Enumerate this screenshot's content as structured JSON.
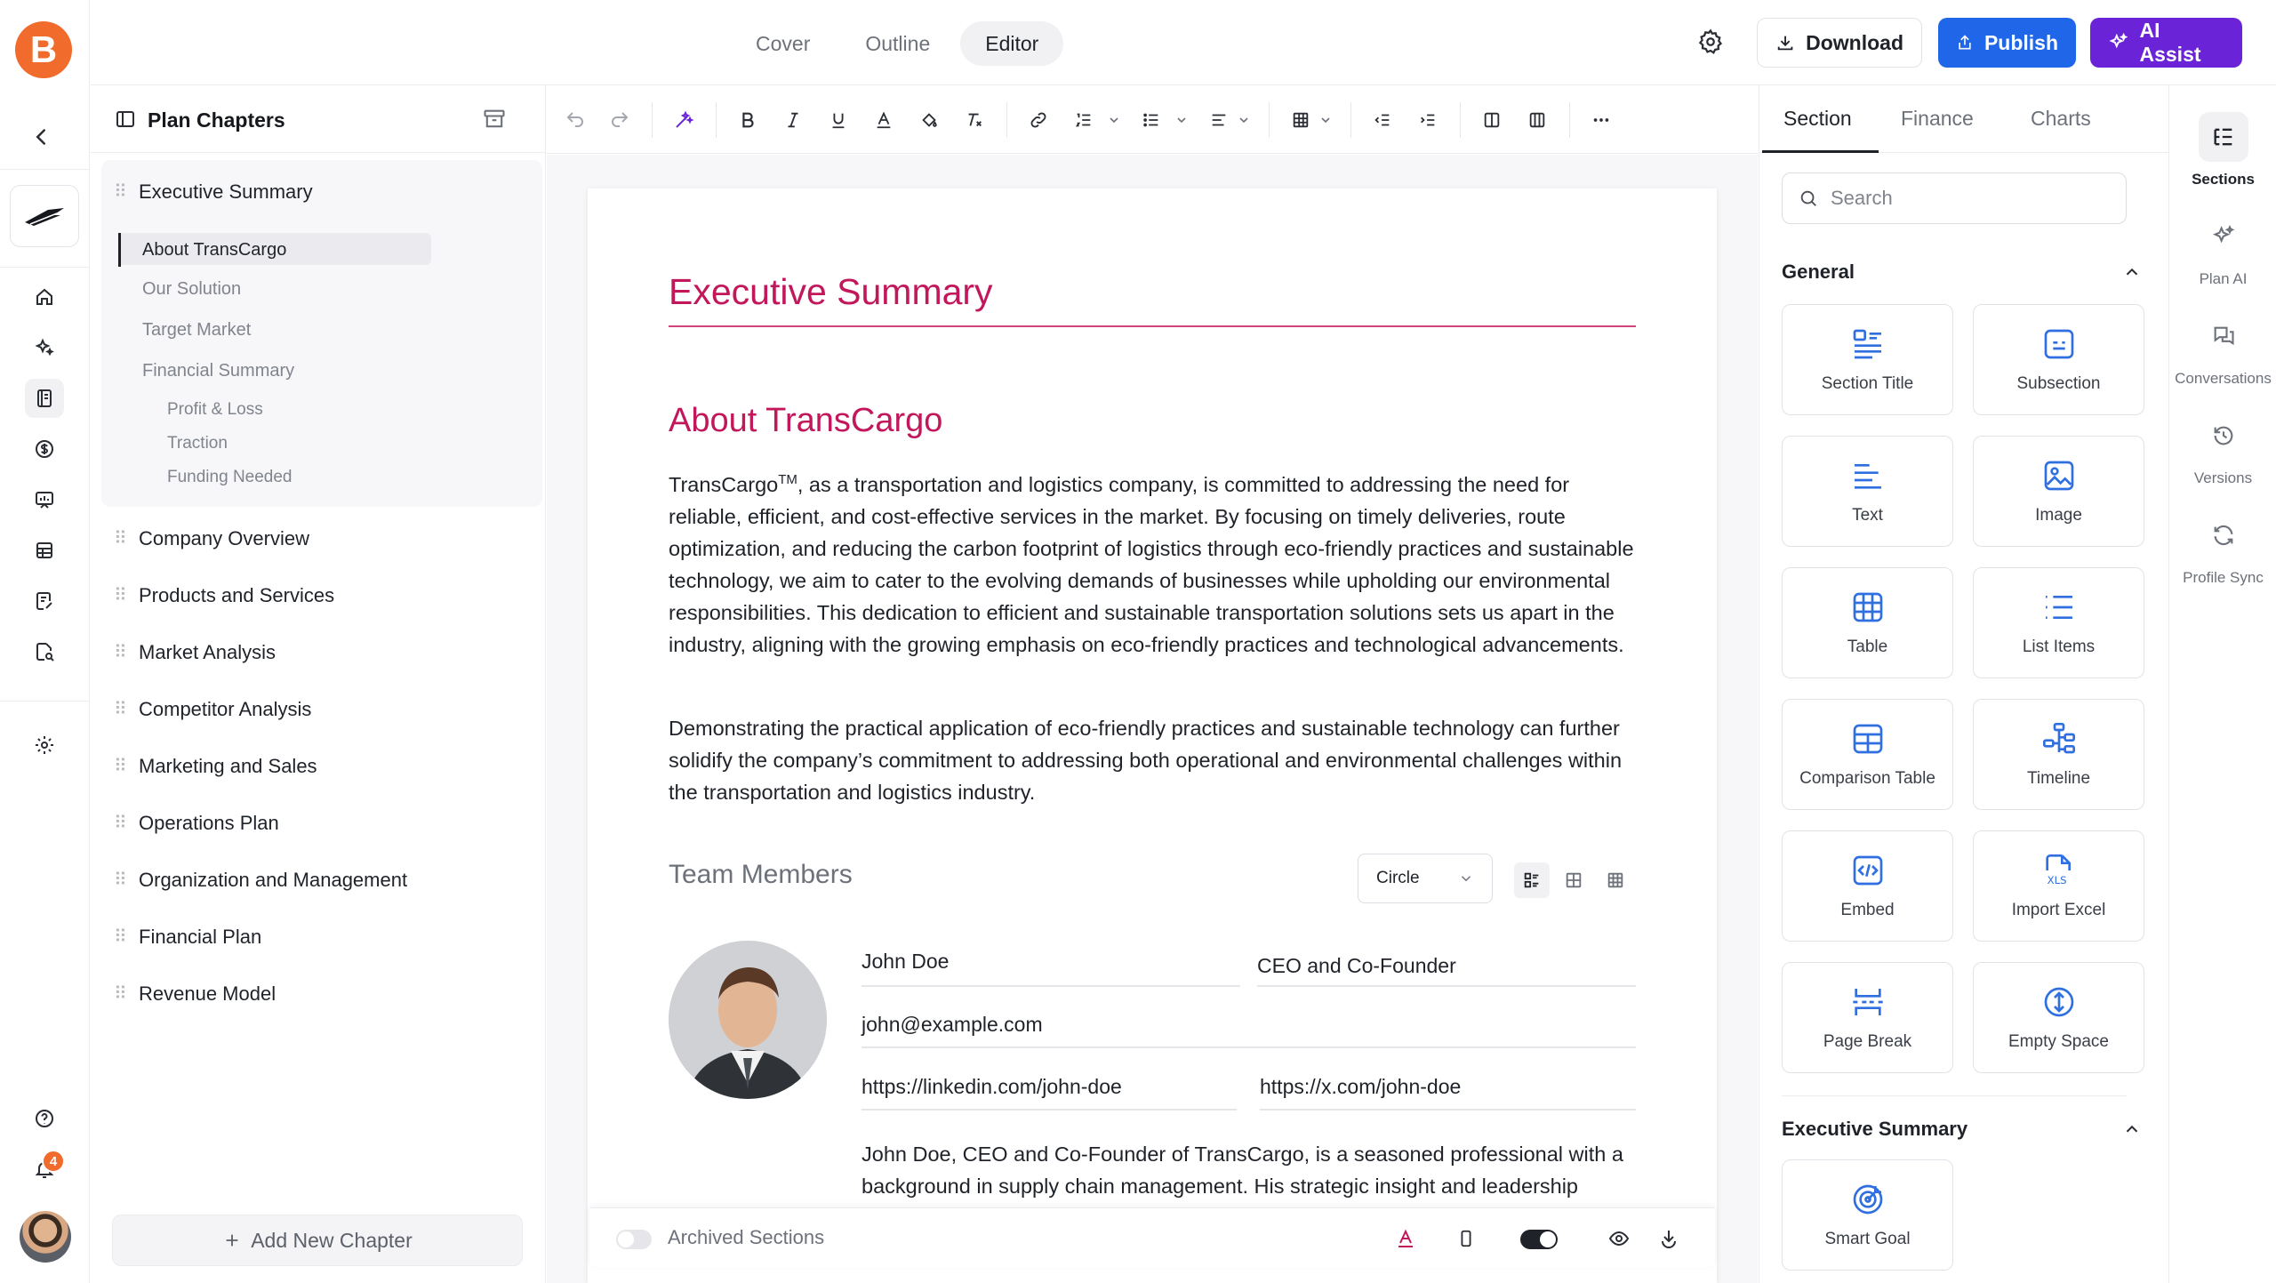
{
  "app": {
    "logo_letter": "B",
    "notification_count": "4"
  },
  "topbar": {
    "tabs": [
      "Cover",
      "Outline",
      "Editor"
    ],
    "active_tab": "Editor",
    "download_label": "Download",
    "publish_label": "Publish",
    "ai_label": "AI Assist",
    "colors": {
      "publish": "#1f67e8",
      "ai": "#6a23d6",
      "brand": "#f06b2c"
    }
  },
  "chapters": {
    "title": "Plan Chapters",
    "active": {
      "label": "Executive Summary",
      "sections": [
        "About TransCargo",
        "Our Solution",
        "Target Market",
        "Financial Summary"
      ],
      "subsections": [
        "Profit & Loss",
        "Traction",
        "Funding Needed"
      ]
    },
    "items": [
      "Company Overview",
      "Products and Services",
      "Market Analysis",
      "Competitor Analysis",
      "Marketing and Sales",
      "Operations Plan",
      "Organization and Management",
      "Financial Plan",
      "Revenue Model"
    ],
    "add_label": "Add New Chapter"
  },
  "doc": {
    "title": "Executive Summary",
    "section_title": "About TransCargo",
    "para1_lead": "TransCargo",
    "para1_sup": "TM",
    "para1_rest": ", as a transportation and logistics company, is committed to addressing the need for reliable, efficient, and cost-effective services in the market. By focusing on timely deliveries, route optimization, and reducing the carbon footprint of logistics through eco-friendly practices and sustainable technology, we aim to cater to the evolving demands of businesses while upholding our environmental responsibilities. This dedication to efficient and sustainable transportation solutions sets us apart in the industry, aligning with the growing emphasis on eco-friendly practices and technological advancements.",
    "para2": "Demonstrating the practical application of eco-friendly practices and sustainable technology can further solidify the company’s commitment to addressing both operational and environmental challenges within the transportation and logistics industry.",
    "team": {
      "title": "Team Members",
      "shape": "Circle",
      "member": {
        "name": "John Doe",
        "role": "CEO and Co-Founder",
        "email": "john@example.com",
        "linkedin": "https://linkedin.com/john-doe",
        "x": "https://x.com/john-doe",
        "bio": "John Doe, CEO and Co-Founder of TransCargo, is a seasoned professional with a background in supply chain management. His strategic insight and leadership"
      }
    },
    "archived_label": "Archived Sections",
    "accent": "#c2185b"
  },
  "rightpanel": {
    "tabs": [
      "Section",
      "Finance",
      "Charts"
    ],
    "active_tab": "Section",
    "search_placeholder": "Search",
    "general_title": "General",
    "general_cards": [
      {
        "label": "Section Title",
        "icon": "section-title-icon"
      },
      {
        "label": "Subsection",
        "icon": "subsection-icon"
      },
      {
        "label": "Text",
        "icon": "text-icon"
      },
      {
        "label": "Image",
        "icon": "image-icon"
      },
      {
        "label": "Table",
        "icon": "table-icon"
      },
      {
        "label": "List Items",
        "icon": "list-items-icon"
      },
      {
        "label": "Comparison Table",
        "icon": "comparison-table-icon"
      },
      {
        "label": "Timeline",
        "icon": "timeline-icon"
      },
      {
        "label": "Embed",
        "icon": "embed-icon"
      },
      {
        "label": "Import Excel",
        "icon": "import-excel-icon"
      },
      {
        "label": "Page Break",
        "icon": "page-break-icon"
      },
      {
        "label": "Empty Space",
        "icon": "empty-space-icon"
      }
    ],
    "exec_title": "Executive Summary",
    "exec_cards": [
      {
        "label": "Smart Goal",
        "icon": "smart-goal-icon"
      }
    ]
  },
  "farrail": {
    "items": [
      "Sections",
      "Plan AI",
      "Conversations",
      "Versions",
      "Profile Sync"
    ],
    "active": "Sections"
  }
}
